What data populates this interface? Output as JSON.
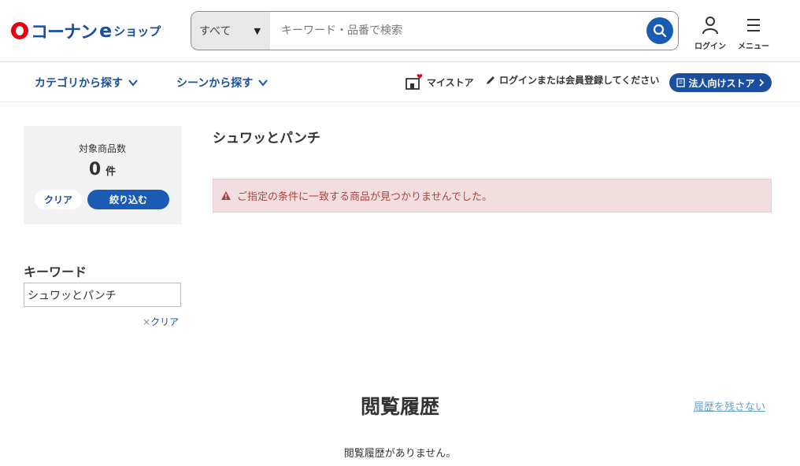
{
  "header": {
    "logo_text": "コーナン",
    "logo_e": "e",
    "logo_sub": "ショップ",
    "search": {
      "category": "すべて",
      "placeholder": "キーワード・品番で検索"
    },
    "login_label": "ログイン",
    "menu_label": "メニュー"
  },
  "nav": {
    "category": "カテゴリから探す",
    "scene": "シーンから探す",
    "my_store": "マイストア",
    "login_register": "ログインまたは会員登録してください",
    "business_store": "法人向けストア"
  },
  "filter": {
    "label": "対象商品数",
    "count": "0",
    "unit": "件",
    "clear": "クリア",
    "narrow": "絞り込む"
  },
  "keyword": {
    "heading": "キーワード",
    "value": "シュワッとパンチ",
    "clear": "クリア",
    "clear_mark": "×"
  },
  "results": {
    "title": "シュワッとパンチ",
    "alert": "ご指定の条件に一致する商品が見つかりませんでした。"
  },
  "history": {
    "title": "閲覧履歴",
    "no_keep": "履歴を残さない",
    "empty": "閲覧履歴がありません。"
  },
  "colors": {
    "brand_blue": "#1a4fa0",
    "brand_red": "#e60012",
    "alert_bg": "#f2dede",
    "alert_text": "#a94442"
  }
}
